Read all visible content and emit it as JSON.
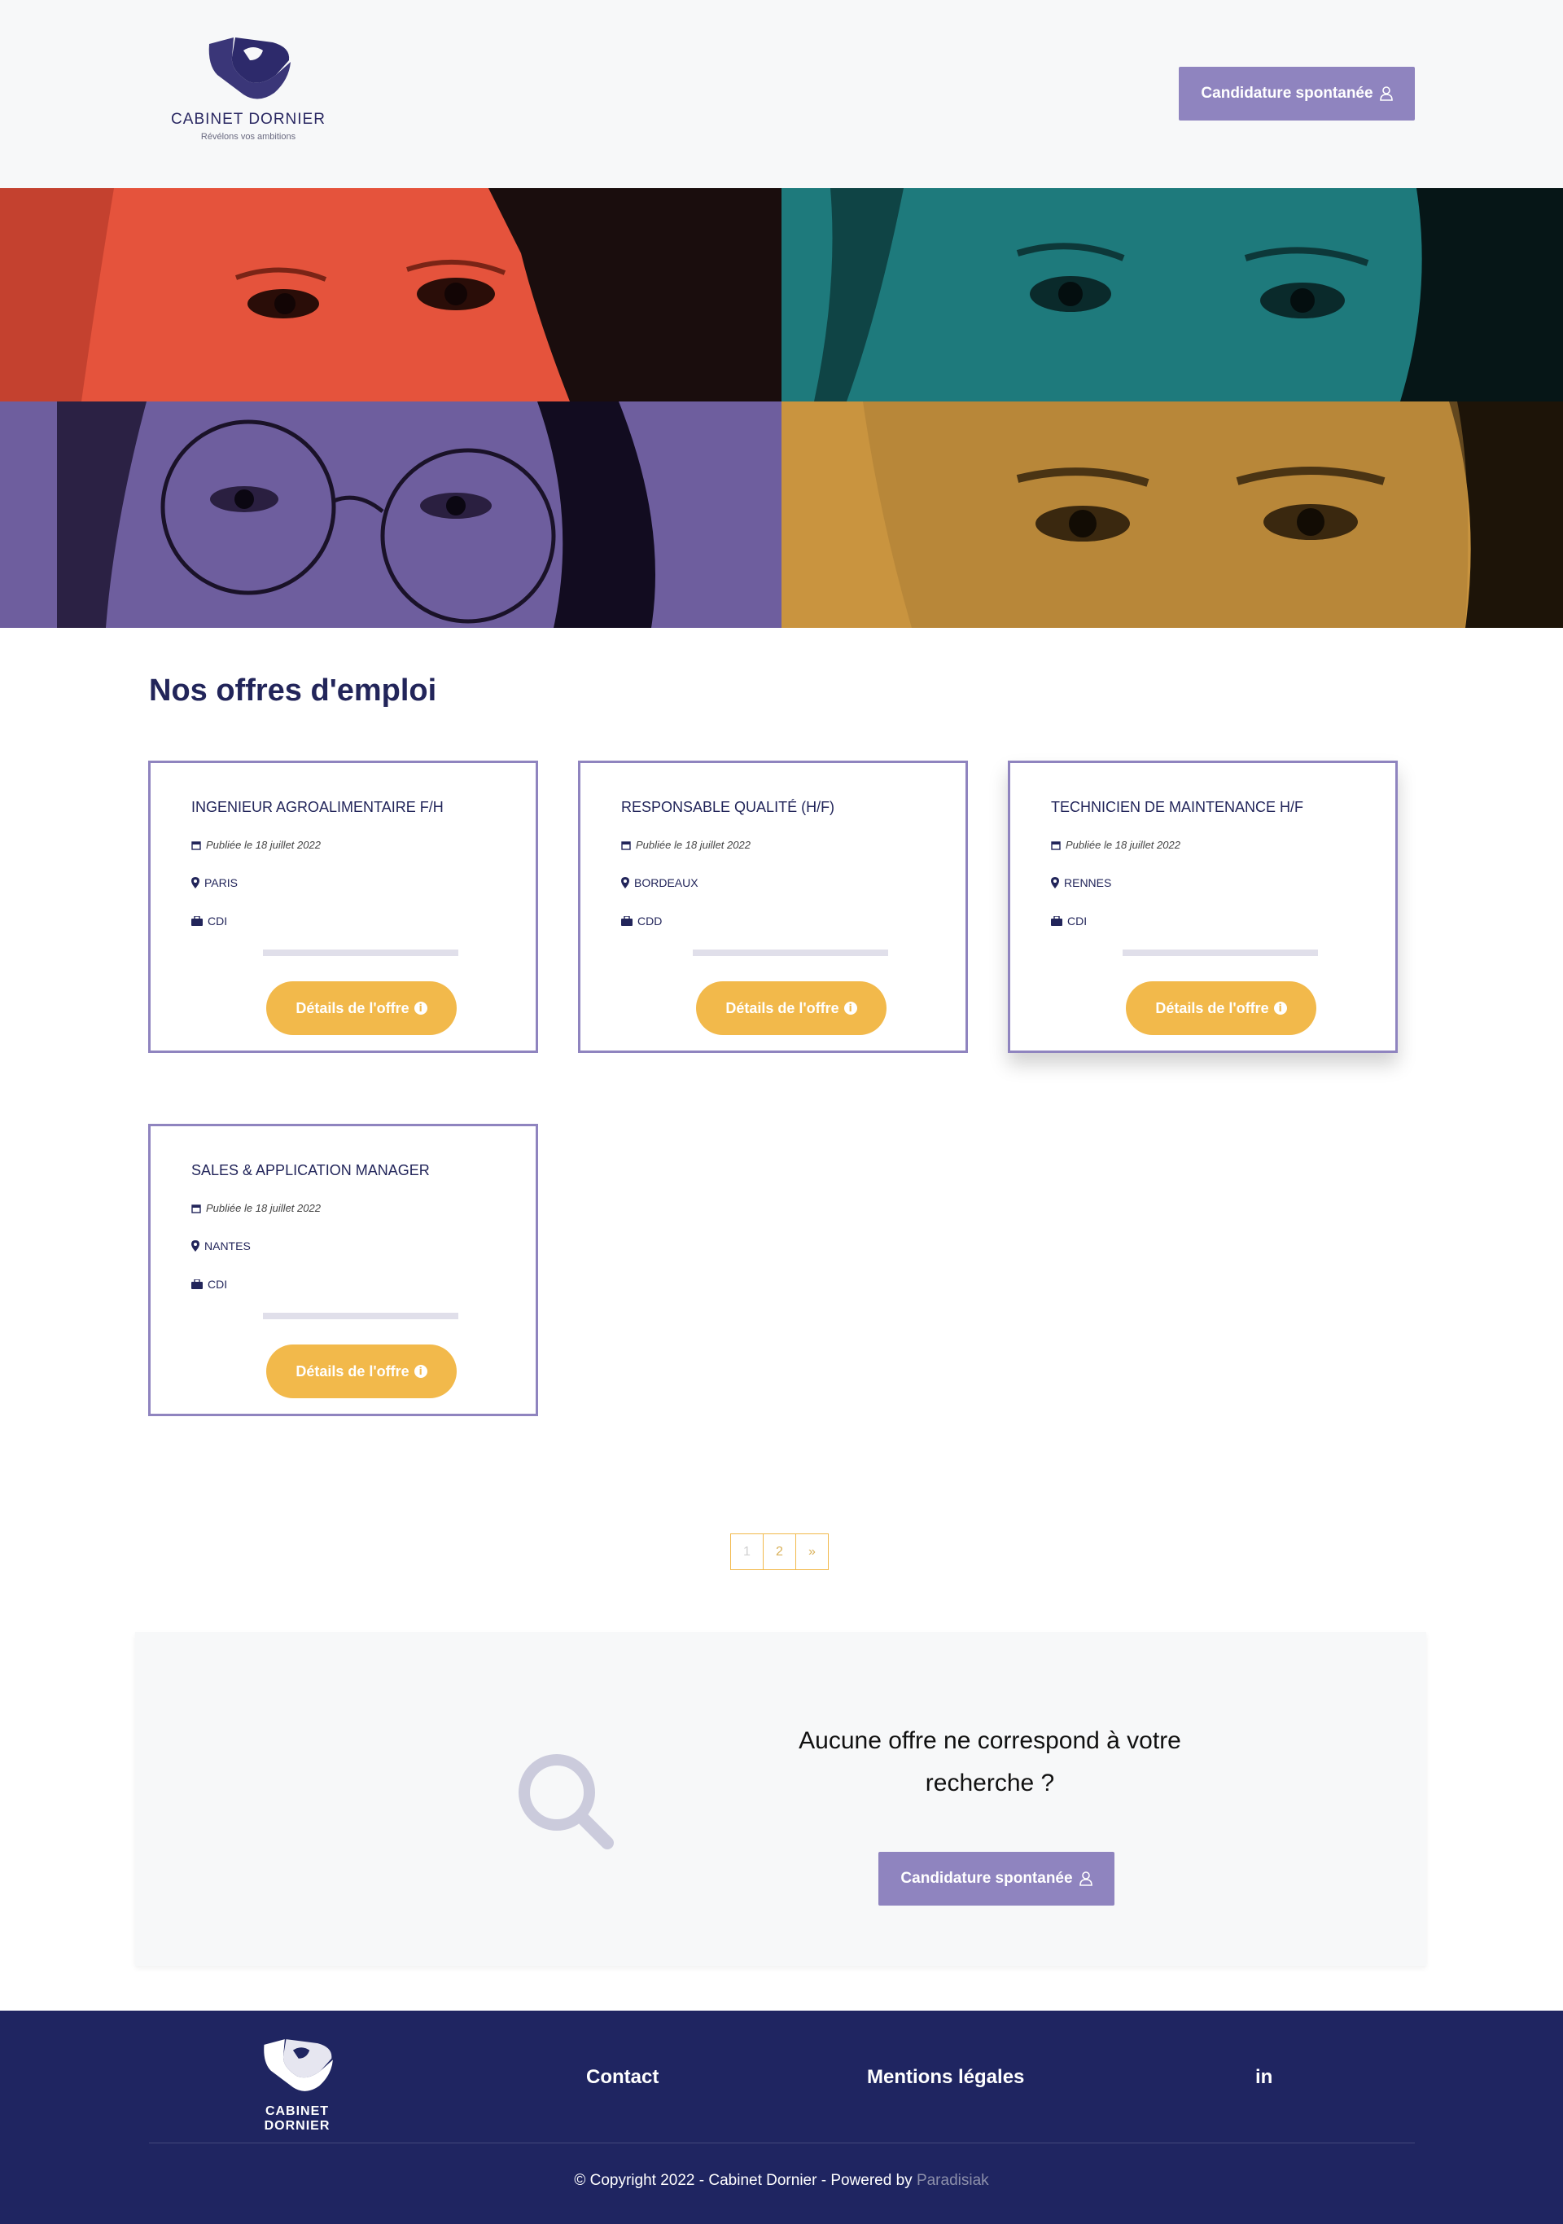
{
  "header": {
    "logo_name": "CABINET DORNIER",
    "logo_tagline": "Révélons vos ambitions",
    "cta_label": "Candidature spontanée",
    "cta_icon": "user-icon"
  },
  "jobs": {
    "section_title": "Nos offres d'emploi",
    "details_label": "Détails de l'offre",
    "cards": [
      {
        "title": "INGENIEUR AGROALIMENTAIRE F/H",
        "date": "Publiée le 18 juillet 2022",
        "location": "PARIS",
        "contract": "CDI"
      },
      {
        "title": "RESPONSABLE QUALITÉ (H/F)",
        "date": "Publiée le 18 juillet 2022",
        "location": "BORDEAUX",
        "contract": "CDD"
      },
      {
        "title": "TECHNICIEN DE MAINTENANCE H/F",
        "date": "Publiée le 18 juillet 2022",
        "location": "RENNES",
        "contract": "CDI"
      },
      {
        "title": "SALES & APPLICATION MANAGER",
        "date": "Publiée le 18 juillet 2022",
        "location": "NANTES",
        "contract": "CDI"
      }
    ]
  },
  "pagination": {
    "pages": [
      "1",
      "2",
      "»"
    ],
    "current": "1"
  },
  "no_offer": {
    "title": "Aucune offre ne correspond à votre recherche ?",
    "cta_label": "Candidature spontanée"
  },
  "footer": {
    "logo_name": "CABINET DORNIER",
    "contact": "Contact",
    "legal": "Mentions légales",
    "social": "in",
    "copyright": "© Copyright 2022 - Cabinet Dornier - Powered by ",
    "powered_by": "Paradisiak"
  },
  "colors": {
    "brand_purple": "#8f84bf",
    "navy": "#1f2561",
    "yellow": "#f2b94b",
    "hero_red": "#e5533c",
    "hero_teal": "#1e7a7c",
    "hero_violet": "#6e5e9e",
    "hero_ochre": "#c9943f"
  }
}
